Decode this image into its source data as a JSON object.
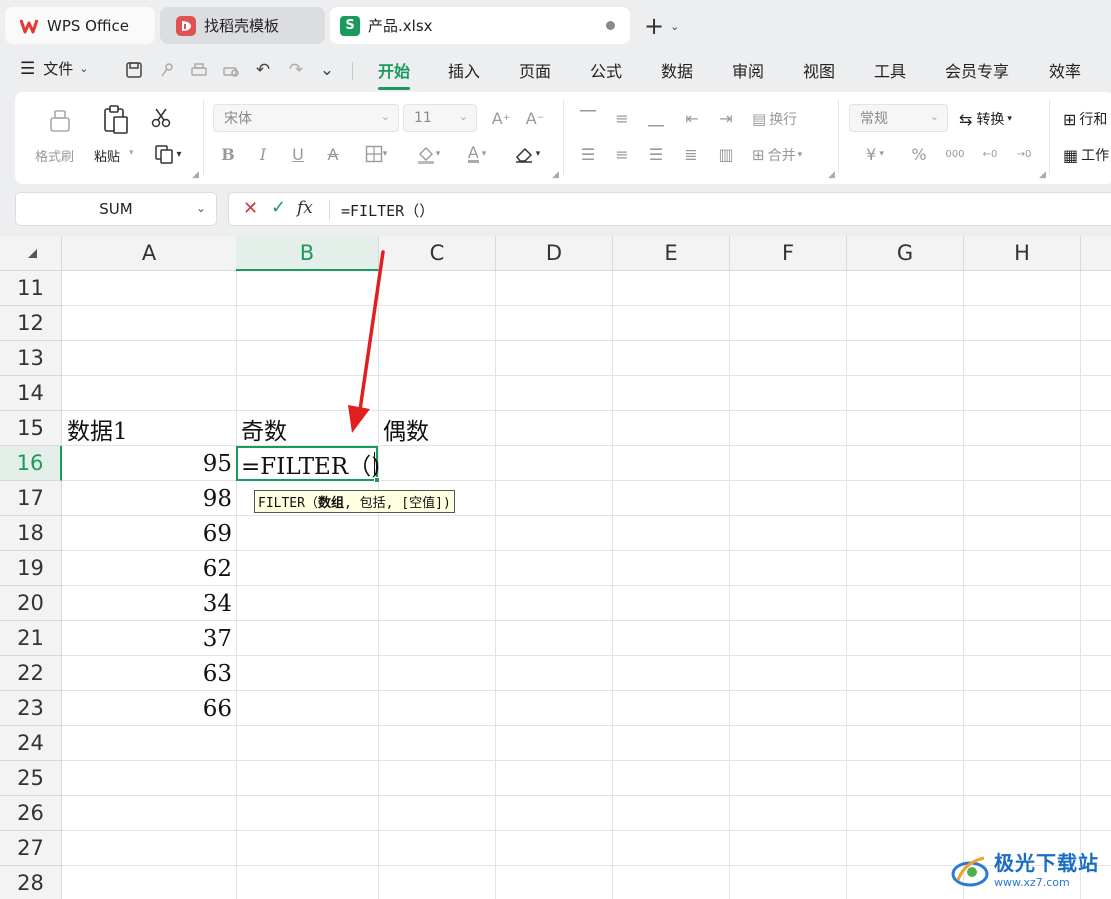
{
  "tabs": {
    "wps": "WPS Office",
    "zhaodaoke": "找稻壳模板",
    "file": "产品.xlsx",
    "add": "+"
  },
  "menu": {
    "file": "文件",
    "items": [
      "开始",
      "插入",
      "页面",
      "公式",
      "数据",
      "审阅",
      "视图",
      "工具",
      "会员专享",
      "效率"
    ],
    "active": "开始"
  },
  "ribbon": {
    "format_painter": "格式刷",
    "paste": "粘贴",
    "font_name": "宋体",
    "font_size": "11",
    "wrap": "换行",
    "merge": "合并",
    "number_format": "常规",
    "convert": "转换",
    "row_col": "行和",
    "worksheet": "工作"
  },
  "formula_bar": {
    "name_box": "SUM",
    "formula": "=FILTER（）"
  },
  "grid": {
    "columns": [
      "A",
      "B",
      "C",
      "D",
      "E",
      "F",
      "G",
      "H"
    ],
    "rows": [
      "11",
      "12",
      "13",
      "14",
      "15",
      "16",
      "17",
      "18",
      "19",
      "20",
      "21",
      "22",
      "23",
      "24",
      "25",
      "26",
      "27",
      "28"
    ],
    "selected_column": "B",
    "selected_row": "16",
    "headers": {
      "A15": "数据1",
      "B15": "奇数",
      "C15": "偶数"
    },
    "data_A": [
      "95",
      "98",
      "69",
      "62",
      "34",
      "37",
      "63",
      "66"
    ],
    "editing_text": "=FILTER（)",
    "tooltip": {
      "fn": "FILTER（",
      "arg1": "数组",
      "rest": ", 包括, [空值])"
    }
  },
  "watermark": {
    "title": "极光下载站",
    "url": "www.xz7.com"
  },
  "colors": {
    "accent": "#1a9b5c",
    "arrow": "#e02020"
  }
}
